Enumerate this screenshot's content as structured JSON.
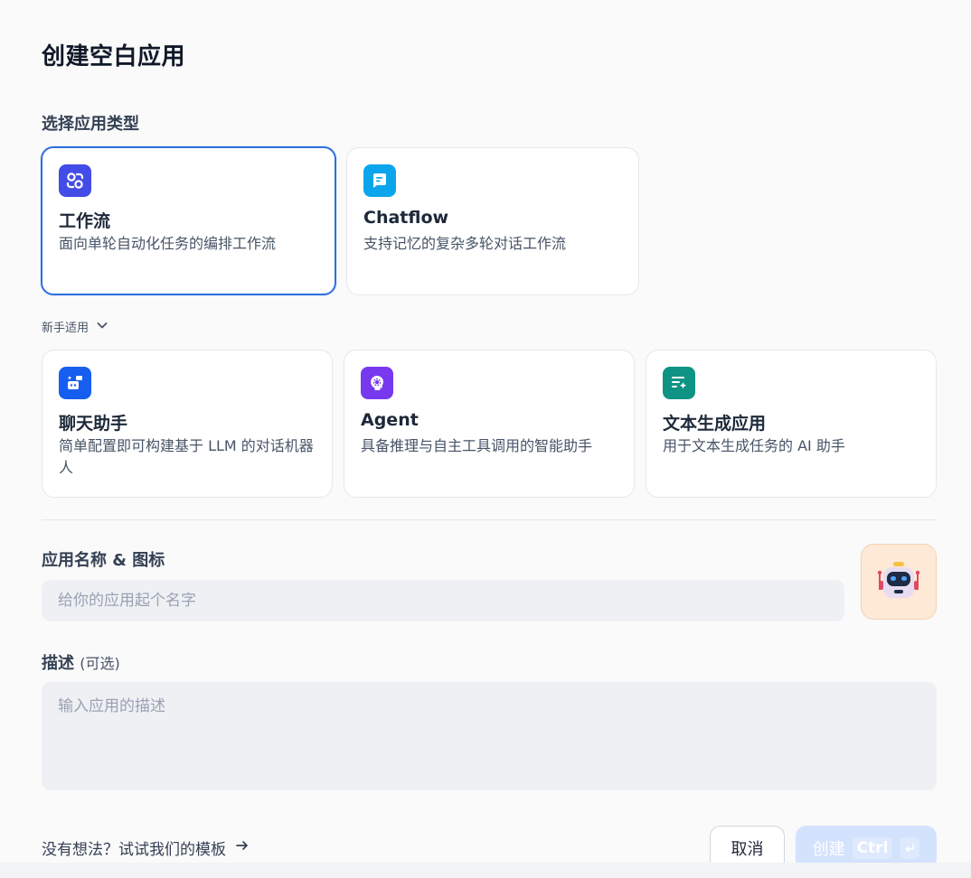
{
  "dialog": {
    "title": "创建空白应用",
    "section_label": "选择应用类型"
  },
  "primary_types": [
    {
      "name": "工作流",
      "desc": "面向单轮自动化任务的编排工作流",
      "icon": "workflow-icon",
      "color": "#444ce7",
      "selected": true
    },
    {
      "name": "Chatflow",
      "desc": "支持记忆的复杂多轮对话工作流",
      "icon": "chatflow-icon",
      "color": "#0ba5ec",
      "selected": false
    }
  ],
  "beginner": {
    "label": "新手适用"
  },
  "beginner_types": [
    {
      "name": "聊天助手",
      "desc": "简单配置即可构建基于 LLM 的对话机器人",
      "icon": "chatbot-icon",
      "color": "#155eef"
    },
    {
      "name": "Agent",
      "desc": "具备推理与自主工具调用的智能助手",
      "icon": "agent-icon",
      "color": "#7839ee"
    },
    {
      "name": "文本生成应用",
      "desc": "用于文本生成任务的 AI 助手",
      "icon": "text-generation-icon",
      "color": "#0e9384"
    }
  ],
  "name_field": {
    "label": "应用名称 & 图标",
    "placeholder": "给你的应用起个名字"
  },
  "desc_field": {
    "label": "描述",
    "optional": "(可选)",
    "placeholder": "输入应用的描述"
  },
  "footer": {
    "template_link": "没有想法？试试我们的模板",
    "cancel": "取消",
    "create": "创建",
    "shortcut": "Ctrl"
  }
}
